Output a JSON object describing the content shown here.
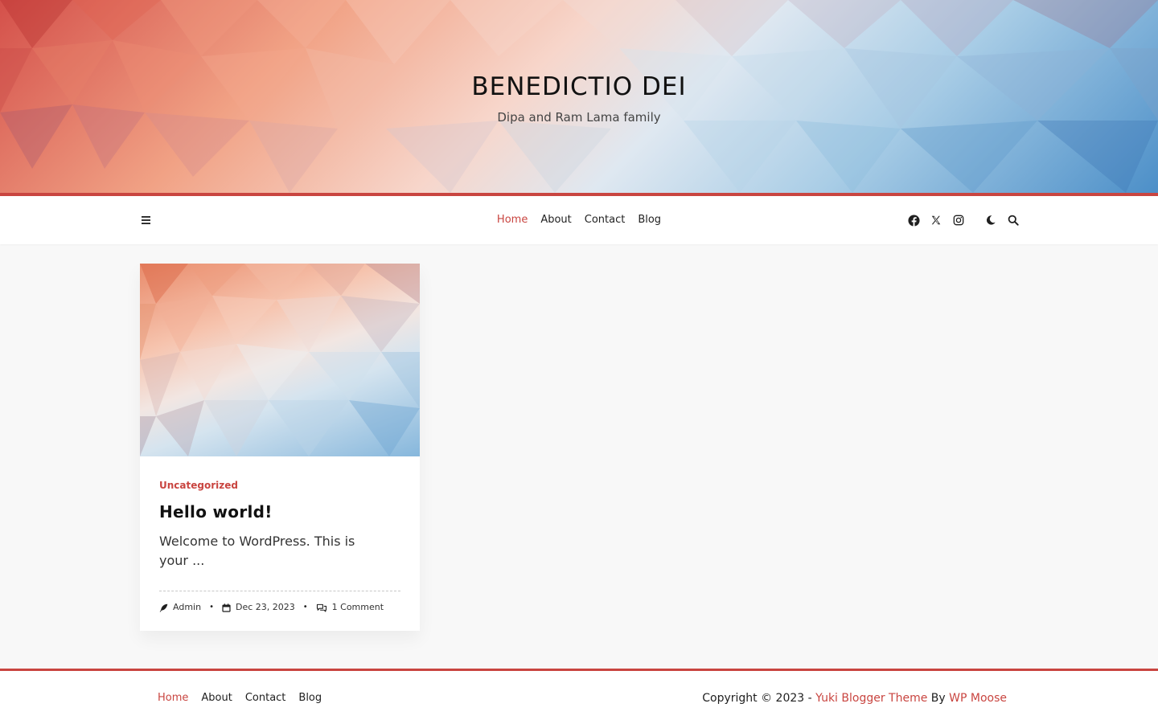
{
  "site": {
    "title": "BENEDICTIO DEI",
    "tagline": "Dipa and Ram Lama family"
  },
  "nav": {
    "menu_icon": "hamburger-icon",
    "items": [
      {
        "label": "Home",
        "active": true
      },
      {
        "label": "About",
        "active": false
      },
      {
        "label": "Contact",
        "active": false
      },
      {
        "label": "Blog",
        "active": false
      }
    ],
    "social_icons": [
      "facebook-icon",
      "x-twitter-icon",
      "instagram-icon"
    ],
    "tools_icons": [
      "dark-mode-moon-icon",
      "search-icon"
    ]
  },
  "post": {
    "category": "Uncategorized",
    "title": "Hello world!",
    "excerpt": "Welcome to WordPress. This is your ...",
    "author": "Admin",
    "date": "Dec 23, 2023",
    "comments": "1 Comment",
    "separator": "•"
  },
  "footer": {
    "nav": [
      {
        "label": "Home",
        "active": true
      },
      {
        "label": "About",
        "active": false
      },
      {
        "label": "Contact",
        "active": false
      },
      {
        "label": "Blog",
        "active": false
      }
    ],
    "copyright_prefix": "Copyright © 2023 - ",
    "theme_link": "Yuki Blogger Theme",
    "by": " By ",
    "author_link": "WP Moose"
  },
  "colors": {
    "accent": "#c94540",
    "text": "#1f1f1f",
    "background": "#f8f8f8"
  }
}
